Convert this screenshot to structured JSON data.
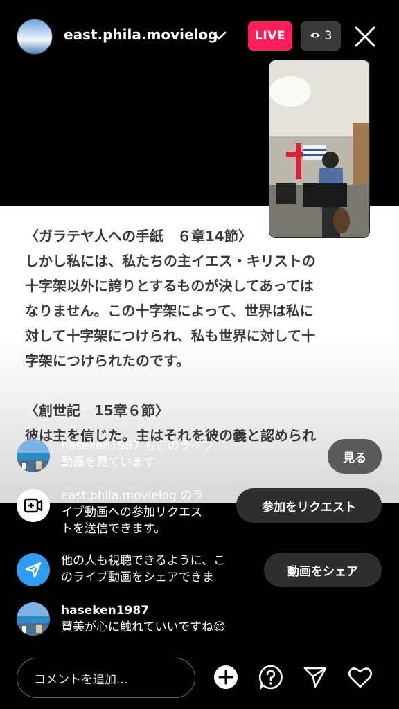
{
  "header": {
    "username": "east.phila.movielog",
    "live_label": "LIVE",
    "viewer_count": "3"
  },
  "scripture": {
    "lines": [
      "〈ガラテヤ人への手紙　６章14節〉",
      "しかし私には、私たちの主イエス・キリストの",
      "十字架以外に誇りとするものが決してあっては",
      "なりません。この十字架によって、世界は私に",
      "対して十字架につけられ、私も世界に対して十",
      "字架につけられたのです。",
      "〈創世記　15章６節〉",
      "彼は主を信じた。主はそれを彼の義と認められ"
    ]
  },
  "comments": {
    "watching": {
      "text_line1": "haseken1987 もこのライブ",
      "text_line2": "動画を見ています",
      "button": "見る"
    },
    "request": {
      "text_line1": "east.phila.movielog のラ",
      "text_line2": "イブ動画への参加リクエス",
      "text_line3": "トを送信できます。",
      "button": "参加をリクエスト"
    },
    "share": {
      "text_line1": "他の人も視聴できるように、こ",
      "text_line2": "のライブ動画をシェアできま",
      "button": "動画をシェア"
    },
    "user_comment": {
      "name": "haseken1987",
      "text": "賛美が心に触れていいですね😄"
    }
  },
  "bottom": {
    "comment_placeholder": "コメントを追加..."
  },
  "colors": {
    "live": "#ff1e5a",
    "share_icon": "#2f9df4"
  }
}
